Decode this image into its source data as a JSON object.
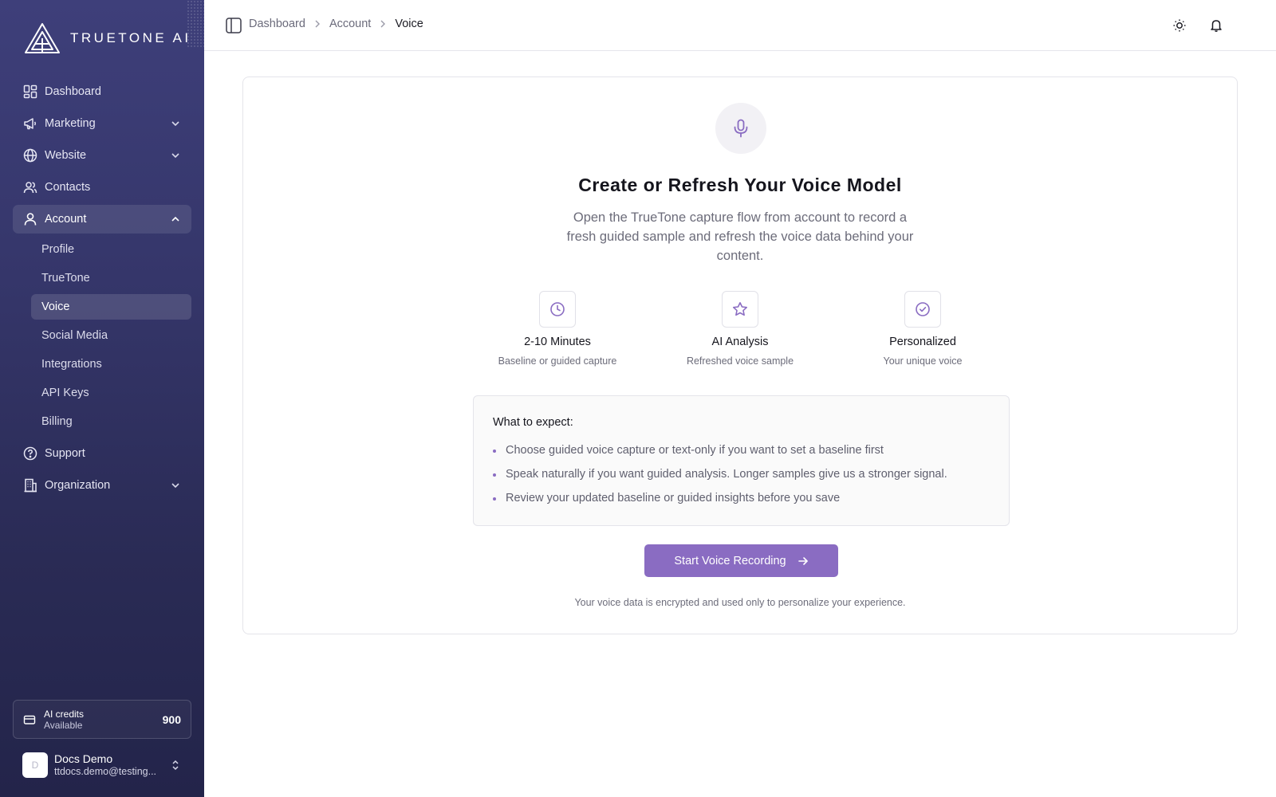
{
  "brand": {
    "name": "TRUETONE AI"
  },
  "sidebar": {
    "nav": [
      {
        "label": "Dashboard",
        "icon": "dashboard-icon"
      },
      {
        "label": "Marketing",
        "icon": "megaphone-icon"
      },
      {
        "label": "Website",
        "icon": "globe-icon"
      },
      {
        "label": "Contacts",
        "icon": "users-icon"
      },
      {
        "label": "Account",
        "icon": "user-icon"
      }
    ],
    "account_sub": [
      {
        "label": "Profile"
      },
      {
        "label": "TrueTone"
      },
      {
        "label": "Voice"
      },
      {
        "label": "Social Media"
      },
      {
        "label": "Integrations"
      },
      {
        "label": "API Keys"
      },
      {
        "label": "Billing"
      }
    ],
    "nav_bottom": [
      {
        "label": "Support",
        "icon": "help-circle-icon"
      },
      {
        "label": "Organization",
        "icon": "building-icon"
      }
    ],
    "credits": {
      "title": "AI credits",
      "subtitle": "Available",
      "value": "900"
    },
    "user": {
      "name": "Docs Demo",
      "email": "ttdocs.demo@testing...",
      "avatar_letter": "D"
    }
  },
  "header": {
    "breadcrumb": [
      "Dashboard",
      "Account",
      "Voice"
    ]
  },
  "main": {
    "title": "Create or Refresh Your Voice Model",
    "description": "Open the TrueTone capture flow from account to record a fresh guided sample and refresh the voice data behind your content.",
    "features": [
      {
        "title": "2-10 Minutes",
        "subtitle": "Baseline or guided capture",
        "icon": "clock-icon"
      },
      {
        "title": "AI Analysis",
        "subtitle": "Refreshed voice sample",
        "icon": "star-icon"
      },
      {
        "title": "Personalized",
        "subtitle": "Your unique voice",
        "icon": "check-circle-icon"
      }
    ],
    "expect": {
      "title": "What to expect:",
      "items": [
        "Choose guided voice capture or text-only if you want to set a baseline first",
        "Speak naturally if you want guided analysis. Longer samples give us a stronger signal.",
        "Review your updated baseline or guided insights before you save"
      ]
    },
    "start_button": "Start Voice Recording",
    "privacy_note": "Your voice data is encrypted and used only to personalize your experience."
  },
  "colors": {
    "accent": "#8a6cc2",
    "sidebar_top": "#3e3f7a",
    "sidebar_bottom": "#23244a"
  }
}
